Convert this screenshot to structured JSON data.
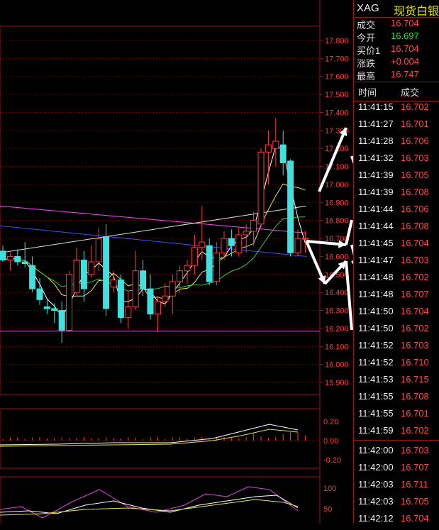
{
  "quote_panel": {
    "symbol": "XAG",
    "name": "现货白银",
    "rows": [
      {
        "label": "成交",
        "value": "16.704",
        "color": "#ff4a4a"
      },
      {
        "label": "今开",
        "value": "16.697",
        "color": "#2ee02e"
      },
      {
        "label": "买价1",
        "value": "16.704",
        "color": "#ff4a4a"
      },
      {
        "label": "涨跌",
        "value": "+0.004",
        "color": "#ff4a4a"
      },
      {
        "label": "最高",
        "value": "16.747",
        "color": "#ff4a4a"
      }
    ]
  },
  "ticks_header": {
    "time": "时间",
    "price": "成交"
  },
  "ticks": [
    {
      "time": "11:41:15",
      "price": "16.702"
    },
    {
      "time": "11:41:27",
      "price": "16.701"
    },
    {
      "time": "11:41:28",
      "price": "16.706"
    },
    {
      "time": "11:41:32",
      "price": "16.703"
    },
    {
      "time": "11:41:39",
      "price": "16.705"
    },
    {
      "time": "11:41:39",
      "price": "16.708"
    },
    {
      "time": "11:41:44",
      "price": "16.706"
    },
    {
      "time": "11:41:44",
      "price": "16.708"
    },
    {
      "time": "11:41:45",
      "price": "16.704"
    },
    {
      "time": "11:41:47",
      "price": "16.703"
    },
    {
      "time": "11:41:48",
      "price": "16.702"
    },
    {
      "time": "11:41:48",
      "price": "16.707"
    },
    {
      "time": "11:41:50",
      "price": "16.704"
    },
    {
      "time": "11:41:50",
      "price": "16.702"
    },
    {
      "time": "11:41:52",
      "price": "16.703"
    },
    {
      "time": "11:41:52",
      "price": "16.710"
    },
    {
      "time": "11:41:53",
      "price": "16.715"
    },
    {
      "time": "11:41:55",
      "price": "16.708"
    },
    {
      "time": "11:41:55",
      "price": "16.701"
    },
    {
      "time": "11:41:59",
      "price": "16.702"
    },
    {
      "time": "11:42:00",
      "price": "16.703"
    },
    {
      "time": "11:42:00",
      "price": "16.707"
    },
    {
      "time": "11:42:03",
      "price": "16.711"
    },
    {
      "time": "11:42:03",
      "price": "16.705"
    },
    {
      "time": "11:42:12",
      "price": "16.704"
    }
  ],
  "chart_data": {
    "type": "candlestick",
    "price_axis": {
      "min": 15.9,
      "max": 17.8,
      "ticks": [
        "17.800",
        "17.700",
        "17.600",
        "17.500",
        "17.400",
        "17.300",
        "17.200",
        "17.100",
        "17.000",
        "16.900",
        "16.800",
        "16.700",
        "16.600",
        "16.500",
        "16.400",
        "16.300",
        "16.200",
        "16.100",
        "16.000",
        "15.900"
      ]
    },
    "candles": [
      {
        "o": 16.63,
        "h": 16.66,
        "l": 16.57,
        "c": 16.58
      },
      {
        "o": 16.58,
        "h": 16.62,
        "l": 16.52,
        "c": 16.6
      },
      {
        "o": 16.6,
        "h": 16.64,
        "l": 16.55,
        "c": 16.57
      },
      {
        "o": 16.57,
        "h": 16.68,
        "l": 16.54,
        "c": 16.56
      },
      {
        "o": 16.55,
        "h": 16.6,
        "l": 16.4,
        "c": 16.42
      },
      {
        "o": 16.42,
        "h": 16.48,
        "l": 16.33,
        "c": 16.36
      },
      {
        "o": 16.32,
        "h": 16.36,
        "l": 16.28,
        "c": 16.31
      },
      {
        "o": 16.31,
        "h": 16.34,
        "l": 16.23,
        "c": 16.3
      },
      {
        "o": 16.3,
        "h": 16.35,
        "l": 16.12,
        "c": 16.19
      },
      {
        "o": 16.19,
        "h": 16.52,
        "l": 16.18,
        "c": 16.5
      },
      {
        "o": 16.4,
        "h": 16.65,
        "l": 16.38,
        "c": 16.58
      },
      {
        "o": 16.58,
        "h": 16.63,
        "l": 16.35,
        "c": 16.42
      },
      {
        "o": 16.5,
        "h": 16.66,
        "l": 16.48,
        "c": 16.57
      },
      {
        "o": 16.57,
        "h": 16.76,
        "l": 16.52,
        "c": 16.7
      },
      {
        "o": 16.71,
        "h": 16.78,
        "l": 16.27,
        "c": 16.31
      },
      {
        "o": 16.43,
        "h": 16.52,
        "l": 16.4,
        "c": 16.47
      },
      {
        "o": 16.47,
        "h": 16.5,
        "l": 16.23,
        "c": 16.26
      },
      {
        "o": 16.26,
        "h": 16.41,
        "l": 16.2,
        "c": 16.32
      },
      {
        "o": 16.32,
        "h": 16.63,
        "l": 16.3,
        "c": 16.52
      },
      {
        "o": 16.52,
        "h": 16.58,
        "l": 16.38,
        "c": 16.42
      },
      {
        "o": 16.42,
        "h": 16.5,
        "l": 16.25,
        "c": 16.28
      },
      {
        "o": 16.28,
        "h": 16.38,
        "l": 16.18,
        "c": 16.35
      },
      {
        "o": 16.35,
        "h": 16.45,
        "l": 16.32,
        "c": 16.38
      },
      {
        "o": 16.38,
        "h": 16.5,
        "l": 16.28,
        "c": 16.46
      },
      {
        "o": 16.46,
        "h": 16.55,
        "l": 16.4,
        "c": 16.52
      },
      {
        "o": 16.52,
        "h": 16.58,
        "l": 16.45,
        "c": 16.55
      },
      {
        "o": 16.55,
        "h": 16.72,
        "l": 16.5,
        "c": 16.65
      },
      {
        "o": 16.65,
        "h": 16.88,
        "l": 16.58,
        "c": 16.68
      },
      {
        "o": 16.66,
        "h": 16.7,
        "l": 16.44,
        "c": 16.46
      },
      {
        "o": 16.46,
        "h": 16.68,
        "l": 16.44,
        "c": 16.62
      },
      {
        "o": 16.62,
        "h": 16.74,
        "l": 16.58,
        "c": 16.7
      },
      {
        "o": 16.7,
        "h": 16.75,
        "l": 16.6,
        "c": 16.66
      },
      {
        "o": 16.62,
        "h": 16.76,
        "l": 16.6,
        "c": 16.72
      },
      {
        "o": 16.72,
        "h": 16.78,
        "l": 16.62,
        "c": 16.74
      },
      {
        "o": 16.74,
        "h": 16.85,
        "l": 16.66,
        "c": 16.8
      },
      {
        "o": 16.78,
        "h": 17.2,
        "l": 16.76,
        "c": 17.18
      },
      {
        "o": 17.18,
        "h": 17.3,
        "l": 17.0,
        "c": 17.22
      },
      {
        "o": 17.2,
        "h": 17.37,
        "l": 17.1,
        "c": 17.24
      },
      {
        "o": 17.22,
        "h": 17.3,
        "l": 17.05,
        "c": 17.12
      },
      {
        "o": 17.13,
        "h": 17.14,
        "l": 16.6,
        "c": 16.62
      },
      {
        "o": 16.62,
        "h": 16.75,
        "l": 16.6,
        "c": 16.7
      },
      {
        "o": 16.7,
        "h": 16.74,
        "l": 16.62,
        "c": 16.7
      }
    ],
    "lines": [
      {
        "color": "#ff44ff",
        "y0": 16.88,
        "y1": 16.73
      },
      {
        "color": "#4a4aff",
        "y0": 16.77,
        "y1": 16.6
      },
      {
        "color": "#e0e0e0",
        "y0": 16.62,
        "y1": 16.88
      }
    ],
    "support_line": 16.185,
    "macd_axis": {
      "ticks": [
        "0.20",
        "0.00",
        "-0.20"
      ]
    },
    "osc_axis": {
      "ticks": [
        "100",
        "50"
      ]
    }
  }
}
